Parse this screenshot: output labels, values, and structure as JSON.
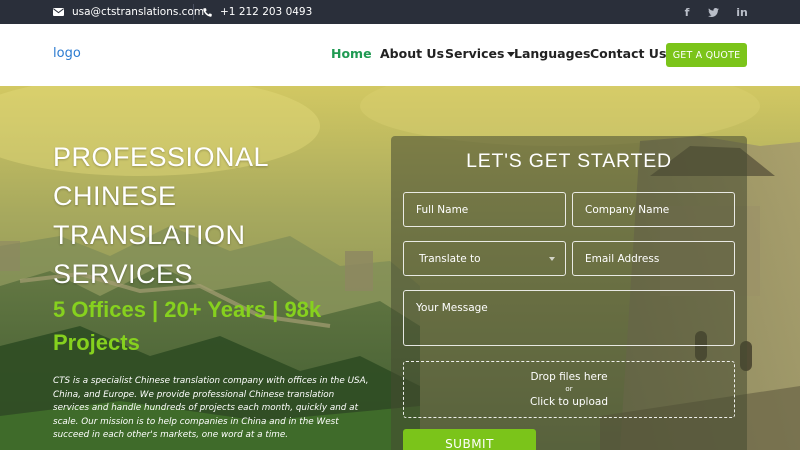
{
  "topbar": {
    "email": "usa@ctstranslations.com",
    "phone": "+1 212 203 0493",
    "social": [
      {
        "name": "facebook",
        "glyph": "f"
      },
      {
        "name": "twitter",
        "glyph": "t"
      },
      {
        "name": "linkedin",
        "glyph": "in"
      }
    ]
  },
  "nav": {
    "logo": "logo",
    "items": [
      {
        "label": "Home",
        "active": true
      },
      {
        "label": "About Us"
      },
      {
        "label": "Services"
      },
      {
        "label": "Languages"
      },
      {
        "label": "Contact Us"
      }
    ],
    "cta": "GET A QUOTE"
  },
  "hero": {
    "title_lines": [
      "PROFESSIONAL",
      "CHINESE",
      "TRANSLATION",
      "SERVICES"
    ],
    "subtitle_lines": [
      "5 Offices | 20+ Years | 98k",
      "Projects"
    ],
    "description": "CTS is a specialist Chinese translation company with offices in the USA, China, and Europe. We provide professional Chinese translation services and handle hundreds of projects each month, quickly and at scale. Our mission is to help companies in China and in the West succeed in each other's markets, one word at a time."
  },
  "form": {
    "title": "LET'S GET STARTED",
    "full_name_placeholder": "Full Name",
    "company_placeholder": "Company Name",
    "translate_to": "Translate to",
    "email_placeholder": "Email Address",
    "message_placeholder": "Your Message",
    "drop_line1": "Drop files here",
    "drop_line2": "or",
    "drop_line3": "Click to upload",
    "submit": "SUBMIT"
  },
  "colors": {
    "topbar_bg": "#2a2f3a",
    "accent_green": "#7bc41a",
    "home_link": "#1f9a52",
    "logo_blue": "#2b7bd1",
    "subtitle_green": "#86d11e"
  }
}
